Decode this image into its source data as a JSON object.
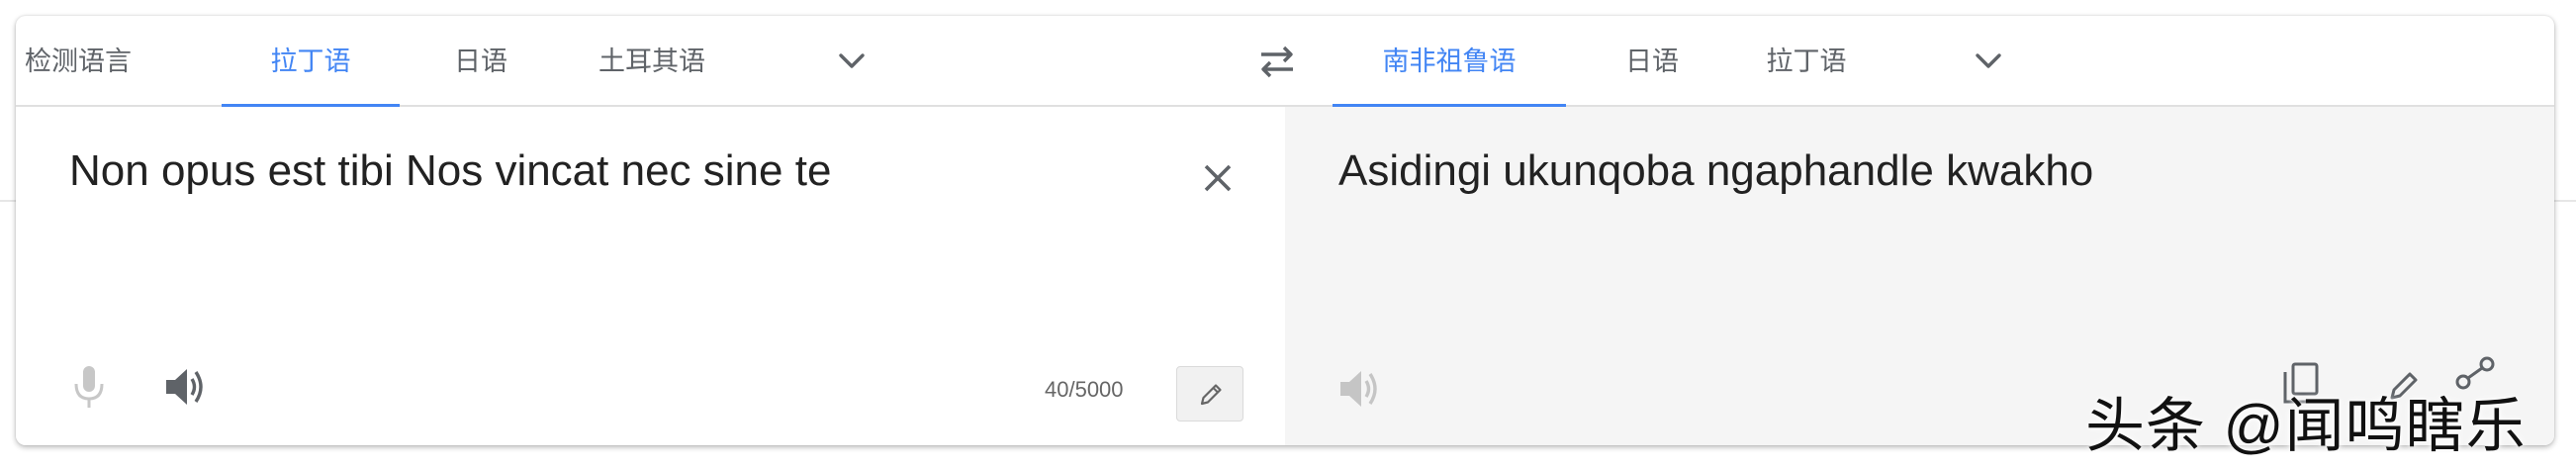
{
  "source_languages": {
    "tabs": [
      {
        "label": "检测语言",
        "active": false
      },
      {
        "label": "拉丁语",
        "active": true
      },
      {
        "label": "日语",
        "active": false
      },
      {
        "label": "土耳其语",
        "active": false
      }
    ],
    "more_icon": "chevron-down-icon"
  },
  "swap_icon": "swap-arrows-icon",
  "target_languages": {
    "tabs": [
      {
        "label": "南非祖鲁语",
        "active": true
      },
      {
        "label": "日语",
        "active": false
      },
      {
        "label": "拉丁语",
        "active": false
      }
    ],
    "more_icon": "chevron-down-icon"
  },
  "source": {
    "text": "Non opus est tibi Nos vincat nec sine te",
    "char_count": "40/5000",
    "clear_icon": "close-icon",
    "mic_icon": "microphone-icon",
    "listen_icon": "speaker-icon",
    "edit_icon": "pencil-icon"
  },
  "target": {
    "text": "Asidingi ukunqoba ngaphandle kwakho",
    "listen_icon": "speaker-icon"
  },
  "watermark": {
    "text": "头条 @闻鸣瞎乐"
  },
  "colors": {
    "accent": "#4285f4",
    "tab_text": "#5f6368",
    "target_bg": "#f5f5f5"
  }
}
